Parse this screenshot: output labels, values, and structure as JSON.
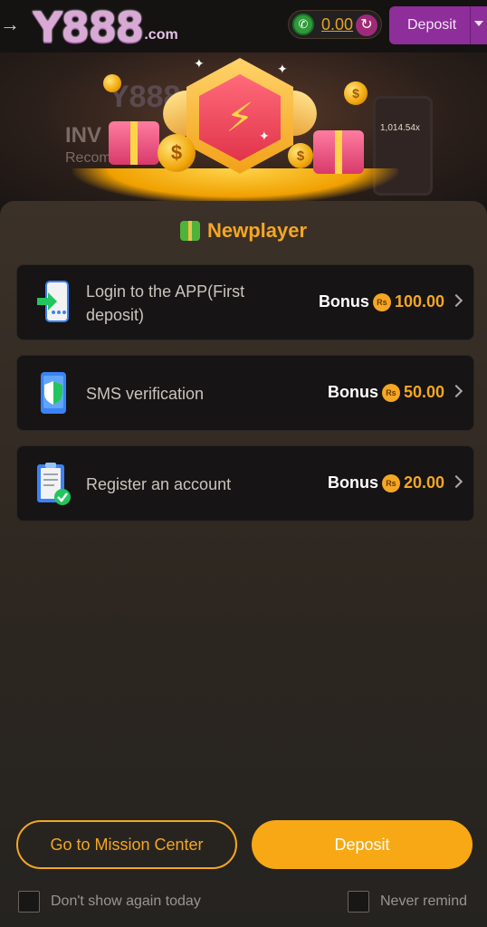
{
  "header": {
    "logo_main": "Y888",
    "logo_sub": ".com",
    "balance": "0.00",
    "deposit_label": "Deposit"
  },
  "banner": {
    "ghost_text_1": "INV",
    "ghost_text_2": "Recom",
    "ghost_logo": "Y888",
    "phone_value": "1,014.54x"
  },
  "modal": {
    "title": "Newplayer",
    "tasks": [
      {
        "label": "Login to the APP(First deposit)",
        "bonus_word": "Bonus",
        "currency": "Rs",
        "amount": "100.00"
      },
      {
        "label": "SMS verification",
        "bonus_word": "Bonus",
        "currency": "Rs",
        "amount": "50.00"
      },
      {
        "label": "Register an account",
        "bonus_word": "Bonus",
        "currency": "Rs",
        "amount": "20.00"
      }
    ],
    "mission_button": "Go to Mission Center",
    "deposit_button": "Deposit",
    "check_today": "Don't show again today",
    "check_never": "Never remind"
  },
  "colors": {
    "accent": "#f5a623",
    "header_deposit": "#8e2e9a",
    "card_bg": "#161414"
  }
}
